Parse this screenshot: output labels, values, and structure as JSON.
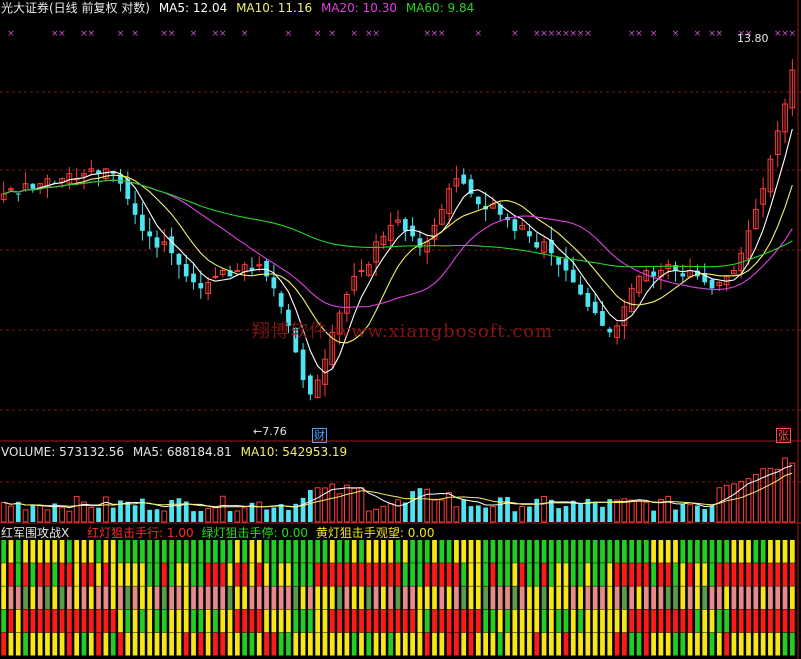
{
  "header": {
    "title": "光大证券(日线 前复权 对数)",
    "ma5": "MA5: 12.04",
    "ma10": "MA10: 11.16",
    "ma20": "MA20: 10.30",
    "ma60": "MA60: 9.84"
  },
  "volume_header": {
    "volume": "VOLUME: 573132.56",
    "ma5": "MA5: 688184.81",
    "ma10": "MA10: 542953.19"
  },
  "indicator_header": {
    "name": "红军围攻战X",
    "red": "红灯狙击手行: 1.00",
    "green": "绿灯狙击手停: 0.00",
    "yellow": "黄灯狙击手观望: 0.00"
  },
  "watermark": "翔博软件 www.xiangbosoft.com",
  "annotations": {
    "high_label": "13.80",
    "low_label": "←7.76",
    "cai_badge": "财",
    "zhang_badge": "张"
  },
  "colors": {
    "up": "#ff3b3b",
    "down": "#4fe3f0",
    "ma5": "#ffffff",
    "ma10": "#f5f06a",
    "ma20": "#e040e0",
    "ma60": "#28d228",
    "marker": "#d04fd0",
    "ind_red": "#ff1a1a",
    "ind_green": "#22cc22",
    "ind_yellow": "#f5e614",
    "ind_pink": "#e88a8a",
    "ind_olive": "#5a9a4a"
  },
  "chart_data": [
    {
      "type": "candlestick",
      "title": "光大证券(日线 前复权 对数)",
      "scale": "log",
      "series": [
        {
          "name": "MA5",
          "last": 12.04
        },
        {
          "name": "MA10",
          "last": 11.16
        },
        {
          "name": "MA20",
          "last": 10.3
        },
        {
          "name": "MA60",
          "last": 9.84
        }
      ],
      "annotated_high": 13.8,
      "annotated_low": 7.76,
      "closes": [
        11.1,
        11.2,
        11.1,
        11.3,
        11.2,
        11.3,
        11.4,
        11.3,
        11.4,
        11.5,
        11.4,
        11.5,
        11.6,
        11.5,
        11.6,
        11.5,
        11.3,
        11.0,
        10.7,
        10.4,
        10.3,
        10.1,
        10.2,
        10.0,
        9.8,
        9.6,
        9.5,
        9.4,
        9.5,
        9.6,
        9.7,
        9.6,
        9.7,
        9.8,
        9.7,
        9.8,
        9.6,
        9.4,
        9.1,
        8.8,
        8.4,
        8.0,
        7.8,
        8.0,
        8.3,
        8.7,
        9.0,
        9.3,
        9.6,
        9.7,
        9.8,
        10.2,
        10.3,
        10.5,
        10.6,
        10.4,
        10.3,
        10.1,
        10.2,
        10.5,
        10.8,
        11.2,
        11.4,
        11.3,
        11.1,
        10.9,
        10.8,
        10.9,
        10.7,
        10.6,
        10.4,
        10.5,
        10.3,
        10.1,
        10.2,
        10.0,
        9.8,
        9.7,
        9.5,
        9.3,
        9.1,
        9.0,
        8.8,
        8.7,
        8.8,
        9.1,
        9.4,
        9.6,
        9.7,
        9.6,
        9.7,
        9.8,
        9.7,
        9.6,
        9.7,
        9.6,
        9.5,
        9.4,
        9.5,
        9.6,
        9.7,
        10.0,
        10.4,
        10.8,
        11.2,
        11.8,
        12.4,
        13.0,
        13.8
      ]
    },
    {
      "type": "bar",
      "title": "VOLUME",
      "series": [
        {
          "name": "VOLUME",
          "last": 573132.56
        },
        {
          "name": "MA5",
          "last": 688184.81
        },
        {
          "name": "MA10",
          "last": 542953.19
        }
      ]
    },
    {
      "type": "heatmap",
      "title": "红军围攻战X",
      "series": [
        {
          "name": "红灯狙击手行",
          "last": 1.0
        },
        {
          "name": "绿灯狙击手停",
          "last": 0.0
        },
        {
          "name": "黄灯狙击手观望",
          "last": 0.0
        }
      ]
    }
  ]
}
